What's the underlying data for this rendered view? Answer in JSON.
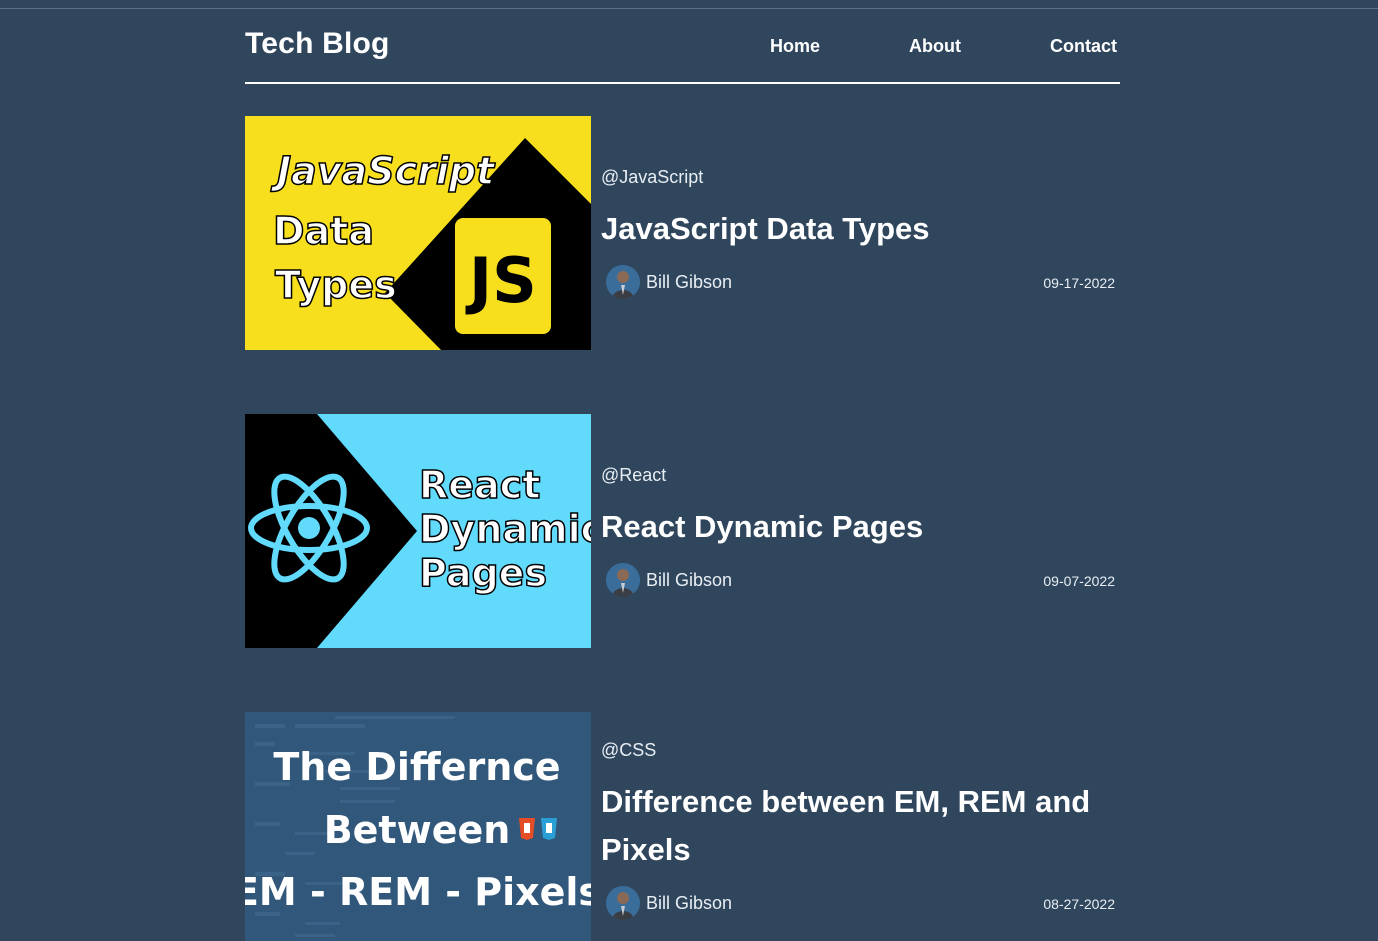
{
  "site": {
    "logo": "Tech Blog",
    "nav": [
      "Home",
      "About",
      "Contact"
    ]
  },
  "posts": [
    {
      "tag": "@JavaScript",
      "title": "JavaScript Data Types",
      "author": "Bill Gibson",
      "date": "09-17-2022",
      "thumb_lines": [
        "JavaScript",
        "Data",
        "Types",
        "JS"
      ]
    },
    {
      "tag": "@React",
      "title": "React Dynamic Pages",
      "author": "Bill Gibson",
      "date": "09-07-2022",
      "thumb_lines": [
        "React",
        "Dynamic",
        "Pages"
      ]
    },
    {
      "tag": "@CSS",
      "title": "Difference between EM, REM and Pixels",
      "author": "Bill Gibson",
      "date": "08-27-2022",
      "thumb_lines": [
        "The Differnce",
        "Between",
        "EM - REM - Pixels"
      ]
    }
  ],
  "colors": {
    "background": "#2f465d",
    "js_yellow": "#f7df1e",
    "react_blue": "#61dafb"
  }
}
